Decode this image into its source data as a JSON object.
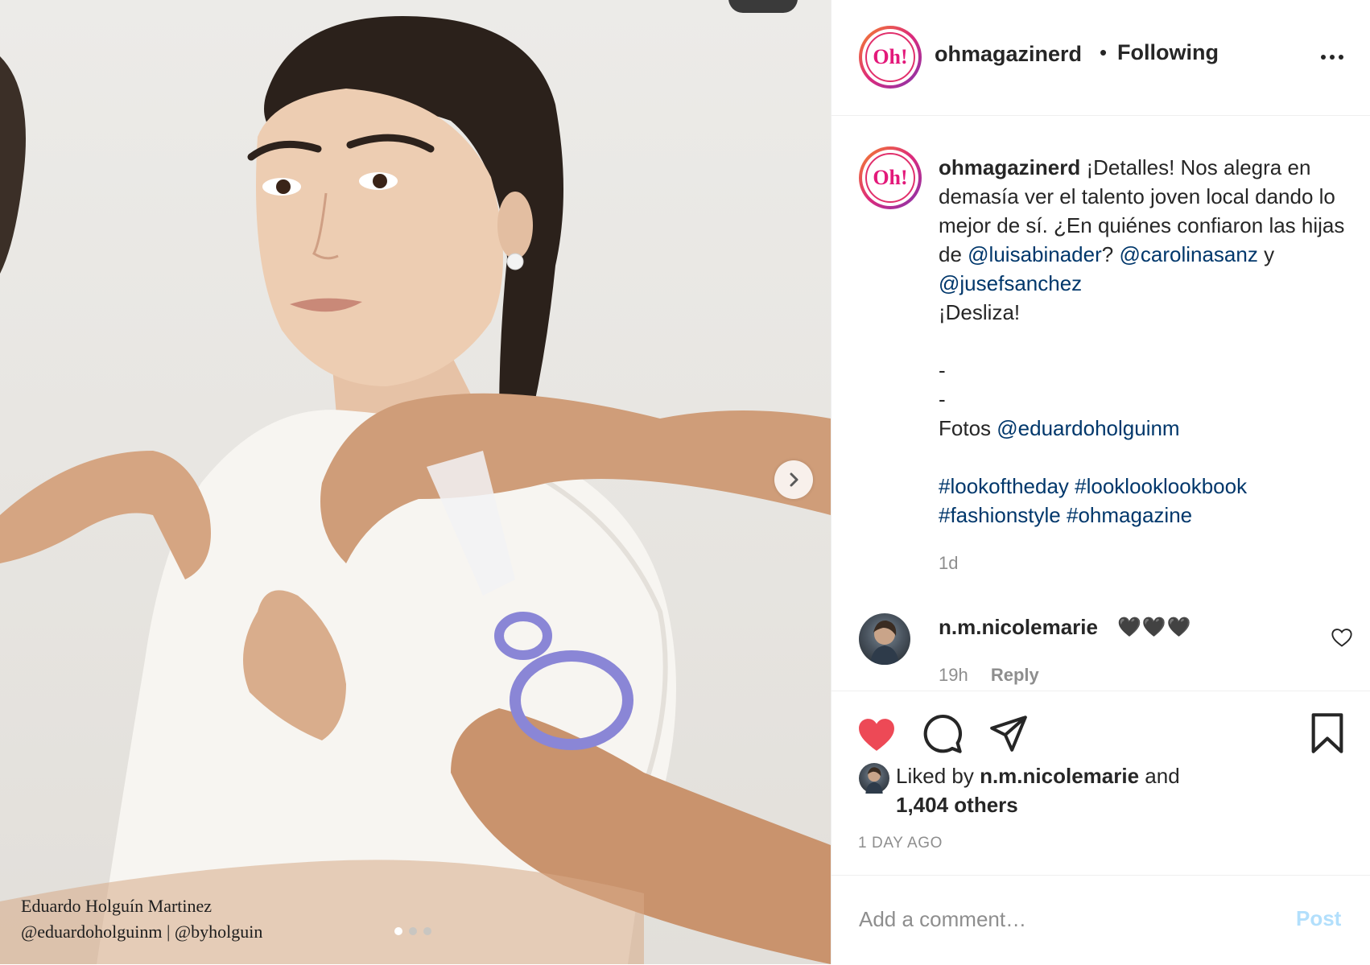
{
  "photo": {
    "caption_line1": "Eduardo Holguín Martinez",
    "caption_line2": "@eduardoholguinm | @byholguin",
    "next_icon": "chevron-right-icon",
    "slide_count": 3,
    "active_slide": 1
  },
  "header": {
    "username": "ohmagazinerd",
    "separator": "•",
    "follow_status": "Following",
    "logo_text": "Oh!",
    "more_icon": "more-horizontal-icon"
  },
  "post": {
    "username": "ohmagazinerd",
    "caption_part1": "¡Detalles! Nos alegra en demasía ver el talento joven local dando lo mejor de sí. ¿En quiénes confiaron las hijas de",
    "mention1": "@luisabinader",
    "q_mark": "?",
    "mention2": "@carolinasanz",
    "conj": "y",
    "mention3": "@jusefsanchez",
    "desliza": "¡Desliza!",
    "dash1": "-",
    "dash2": "-",
    "fotos_label": "Fotos",
    "mention4": "@eduardoholguinm",
    "hashtag1": "#lookoftheday",
    "hashtag2": "#looklooklookbook",
    "hashtag3": "#fashionstyle",
    "hashtag4": "#ohmagazine",
    "time": "1d"
  },
  "comment": {
    "username": "n.m.nicolemarie",
    "text": "🖤🖤🖤",
    "time": "19h",
    "reply_label": "Reply",
    "like_icon": "heart-outline-icon"
  },
  "actions": {
    "like_icon": "heart-filled-icon",
    "like_color": "#ed4956",
    "comment_icon": "comment-icon",
    "share_icon": "paper-plane-icon",
    "save_icon": "bookmark-icon",
    "liked_by_prefix": "Liked by",
    "liked_by_user": "n.m.nicolemarie",
    "liked_by_and": "and",
    "liked_by_others": "1,404 others",
    "posted_ago": "1 DAY AGO"
  },
  "comment_box": {
    "placeholder": "Add a comment…",
    "post_label": "Post",
    "post_color": "#b2dffc"
  }
}
